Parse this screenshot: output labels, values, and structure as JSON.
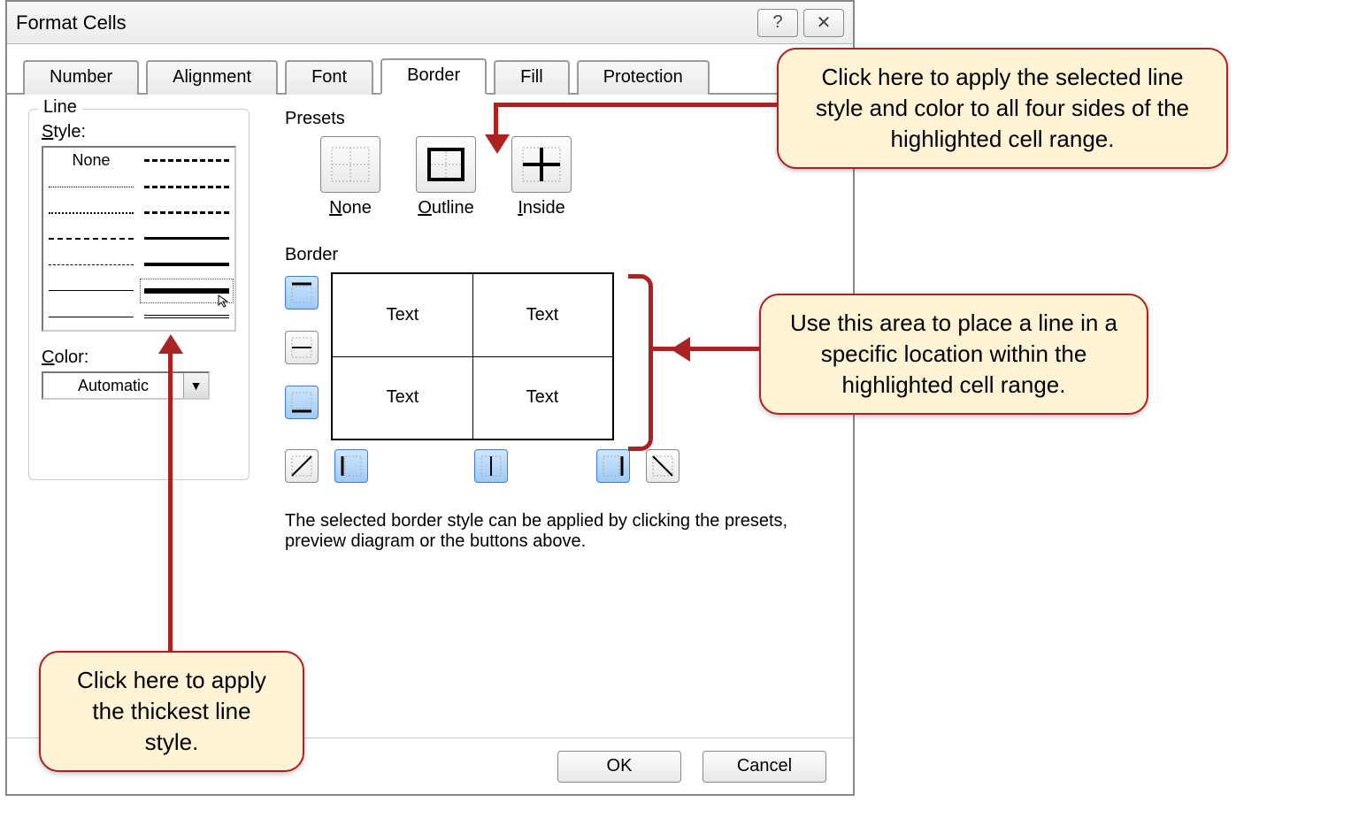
{
  "window": {
    "title": "Format Cells"
  },
  "sysbuttons": {
    "help_char": "?",
    "close_char": "✕"
  },
  "tabs": {
    "number": "Number",
    "alignment": "Alignment",
    "font": "Font",
    "border": "Border",
    "fill": "Fill",
    "protection": "Protection",
    "active": "border"
  },
  "line": {
    "section_label": "Line",
    "style_label": "Style:",
    "none_label": "None",
    "color_label": "Color:",
    "color_value": "Automatic"
  },
  "presets": {
    "section_label": "Presets",
    "none": "None",
    "outline": "Outline",
    "inside": "Inside"
  },
  "border": {
    "section_label": "Border",
    "cell_text": "Text"
  },
  "info": "The selected border style can be applied by clicking the presets, preview diagram or the buttons above.",
  "buttons": {
    "ok": "OK",
    "cancel": "Cancel"
  },
  "callouts": {
    "top": "Click here to apply the selected line style and color to all four sides of the highlighted cell range.",
    "mid": "Use this area to place a line in a specific location within the highlighted cell range.",
    "bottom": "Click here to apply the thickest line style."
  }
}
